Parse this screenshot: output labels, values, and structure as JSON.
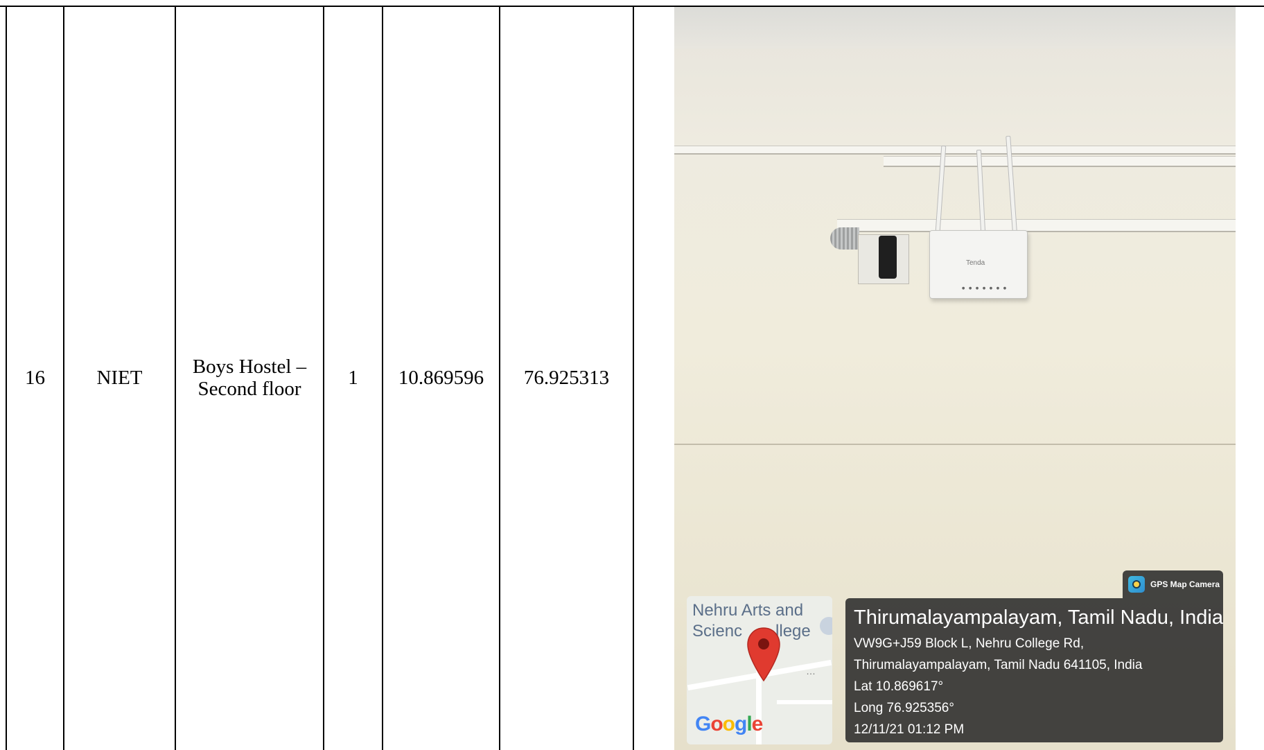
{
  "row": {
    "sno": "16",
    "institution": "NIET",
    "location_line1": "Boys Hostel –",
    "location_line2": "Second floor",
    "count": "1",
    "latitude": "10.869596",
    "longitude": "76.925313"
  },
  "photo": {
    "router_brand": "Tenda",
    "map": {
      "place_line1": "Nehru Arts and",
      "place_line2": "Scienc",
      "place_line2b": "llege",
      "logo": "Google"
    },
    "badge": "GPS Map Camera",
    "info": {
      "title": "Thirumalayampalayam, Tamil Nadu, India",
      "address1": "VW9G+J59 Block L, Nehru College Rd,",
      "address2": "Thirumalayampalayam, Tamil Nadu 641105, India",
      "lat": "Lat 10.869617°",
      "long": "Long 76.925356°",
      "datetime": "12/11/21 01:12 PM"
    }
  }
}
